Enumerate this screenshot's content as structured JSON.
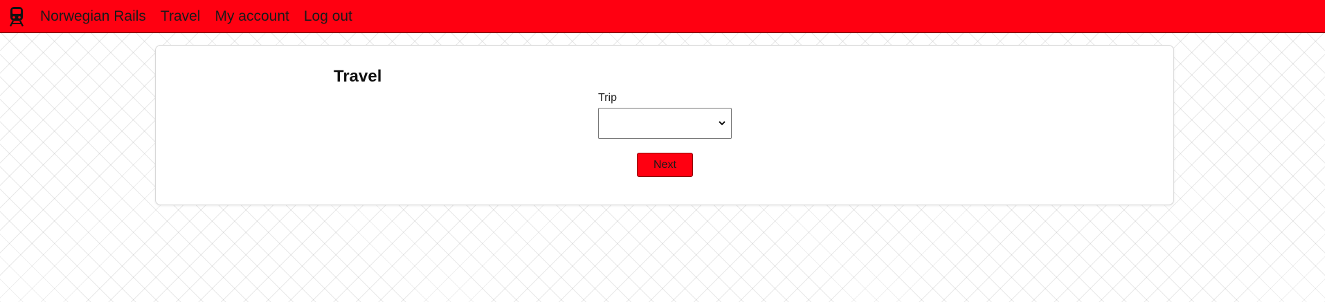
{
  "navbar": {
    "brand_icon": "train-icon",
    "links": [
      {
        "label": "Norwegian Rails"
      },
      {
        "label": "Travel"
      },
      {
        "label": "My account"
      },
      {
        "label": "Log out"
      }
    ],
    "background_color": "#ff0011"
  },
  "main": {
    "title": "Travel",
    "trip_field": {
      "label": "Trip",
      "value": ""
    },
    "next_button": {
      "label": "Next",
      "color": "#ff0011"
    }
  }
}
